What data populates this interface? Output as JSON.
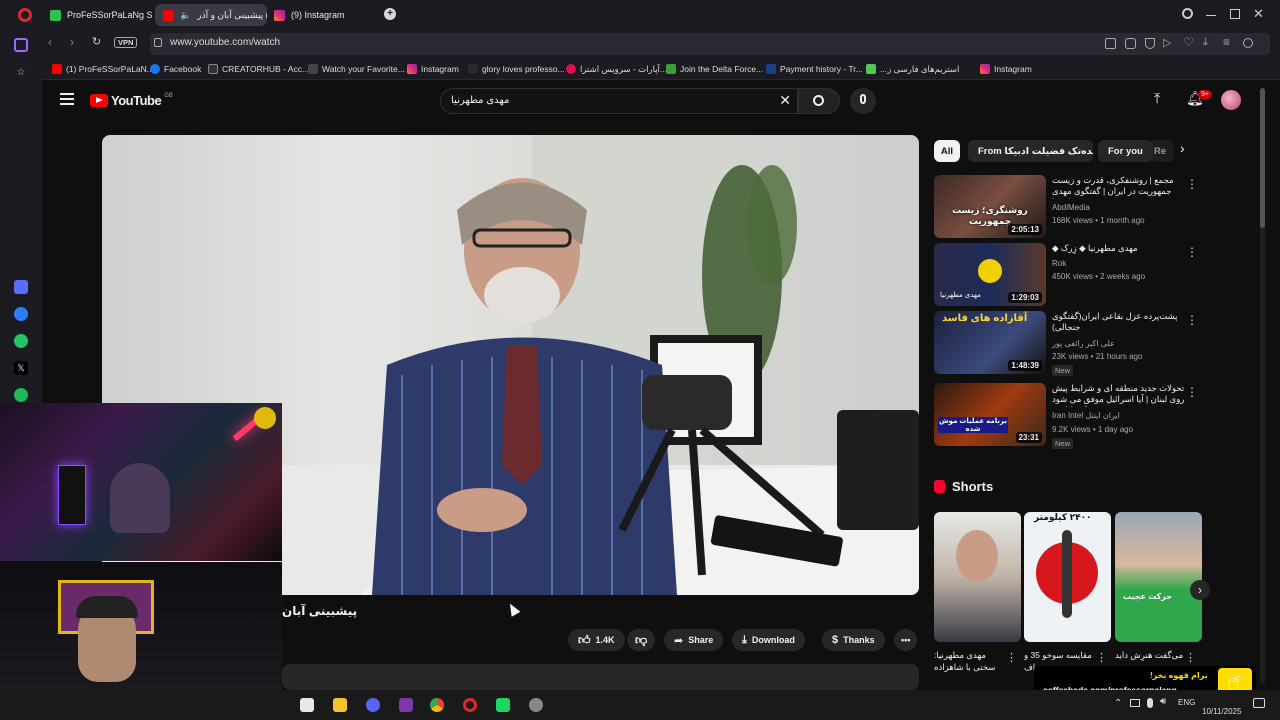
{
  "browser": {
    "tabs": [
      {
        "label": "ProFeSSorPaLaNg Stream"
      },
      {
        "label": "(32) پیشبینی آبان و آذر"
      },
      {
        "label": "(9) Instagram"
      }
    ],
    "vpn": "VPN",
    "url": "www.youtube.com/watch",
    "bookmarks": [
      {
        "label": "(1) ProFeSSorPaLaN..."
      },
      {
        "label": "Facebook"
      },
      {
        "label": "CREATORHUB - Acc..."
      },
      {
        "label": "Watch your Favorite..."
      },
      {
        "label": "Instagram"
      },
      {
        "label": "glory loves professo..."
      },
      {
        "label": "آپارات - سرویس اشترا..."
      },
      {
        "label": "Join the Delta Force..."
      },
      {
        "label": "Payment history - Tr..."
      },
      {
        "label": "استریم‌های فارسی ز..."
      },
      {
        "label": "Instagram"
      }
    ]
  },
  "youtube": {
    "logo": "YouTube",
    "region": "GB",
    "search_value": "مهدی مطهرنیا",
    "notif_count": "9+",
    "chips": [
      "All",
      "From مدرسه ‌ایده‌تک‌ ‌فضیلت ‌ادبیکا",
      "For you",
      "Re"
    ],
    "video_title": "پیشبینی آبان",
    "actions": {
      "likes": "1.4K",
      "share": "Share",
      "download": "Download",
      "thanks": "Thanks"
    },
    "related": [
      {
        "title": "مجمع | روشنفکری، قدرت و زیست جمهوریت در ایران | گفتگوی مهدی مطهرنیا",
        "channel": "AbdiMedia",
        "meta": "168K views • 1 month ago",
        "duration": "2:05:13",
        "overlay": "روشنگری؛ زیست جمهوریت",
        "new": ""
      },
      {
        "title": "مهدی مطهرنیا ◆ زِرک ◆",
        "channel": "Rok",
        "meta": "450K views • 2 weeks ago",
        "duration": "1:29:03",
        "overlay": "مهدی مطهرنیا",
        "new": ""
      },
      {
        "title": "پشت‌پرده عزل بقاعی ایران(گفتگوی جنجالی)",
        "channel": "علی اکبر رائفی پور",
        "meta": "23K views • 21 hours ago",
        "duration": "1:48:39",
        "overlay": "آقازاده های فاسد",
        "new": "New"
      },
      {
        "title": "تحولات جدید منطقه ای و شرایط پیش روی لبنان | آیا اسرائیل موفق می شود ؟ تحلیل ...",
        "channel": "Iran Intel ایران اینتل",
        "meta": "9.2K views • 1 day ago",
        "duration": "23:31",
        "overlay": "برنامه عملیات موش شده",
        "new": "New"
      }
    ],
    "shorts_title": "Shorts",
    "shorts": [
      {
        "title": "مهدی مطهرنیا: سختی با شاهزاده",
        "overlay": ""
      },
      {
        "title": "مقایسه سوخو 35 و اف",
        "overlay": "۲۴۰۰ کیلومتر"
      },
      {
        "title": "می‌گفت هنرِش داید",
        "overlay": "حرکت عجیب"
      }
    ]
  },
  "overlay": {
    "coffee_text": "برام قهوه بخر!",
    "coffee_url": "coffeebede.com/professorpalang"
  },
  "taskbar": {
    "lang": "ENG",
    "date": "10/11/2025"
  }
}
